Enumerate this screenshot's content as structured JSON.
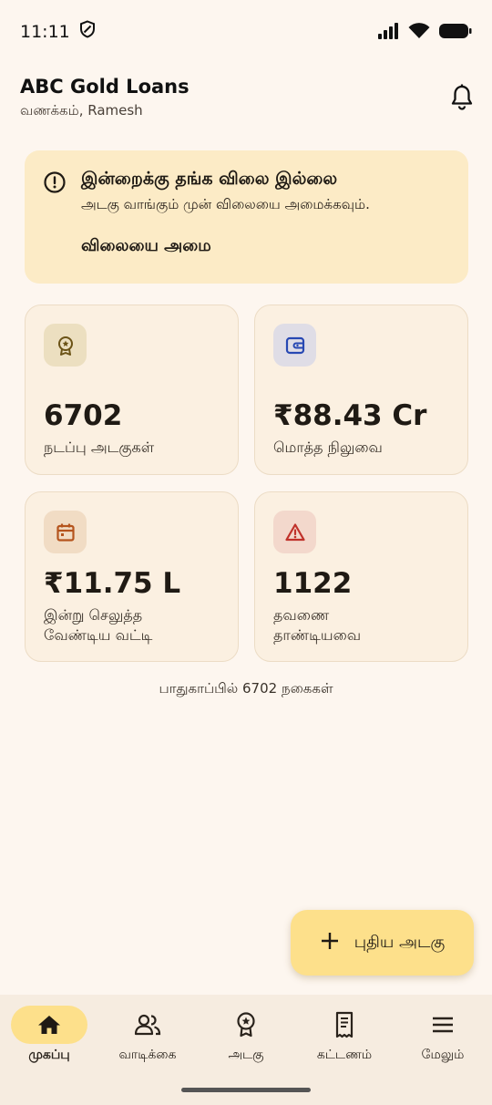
{
  "status_bar": {
    "time": "11:11"
  },
  "header": {
    "title": "ABC Gold Loans",
    "greeting": "வணக்கம், Ramesh"
  },
  "alert": {
    "title": "இன்றைக்கு தங்க விலை இல்லை",
    "subtitle": "அடகு வாங்கும் முன் விலையை அமைக்கவும்.",
    "action_label": "விலையை அமை"
  },
  "stats": [
    {
      "value": "6702",
      "label": "நடப்பு அடகுகள்",
      "icon": "award-icon"
    },
    {
      "value": "₹88.43 Cr",
      "label": "மொத்த நிலுவை",
      "icon": "wallet-icon"
    },
    {
      "value": "₹11.75 L",
      "label_line1": "இன்று செலுத்த",
      "label_line2": "வேண்டிய வட்டி",
      "icon": "calendar-icon"
    },
    {
      "value": "1122",
      "label_line1": "தவணை",
      "label_line2": "தாண்டியவை",
      "icon": "warning-icon"
    }
  ],
  "footnote": "பாதுகாப்பில் 6702 நகைகள்",
  "fab": {
    "label": "புதிய அடகு"
  },
  "nav": [
    {
      "label": "முகப்பு",
      "icon": "home-icon",
      "active": true
    },
    {
      "label": "வாடிக்கை",
      "icon": "users-icon",
      "active": false
    },
    {
      "label": "அடகு",
      "icon": "award-icon",
      "active": false
    },
    {
      "label": "கட்டணம்",
      "icon": "receipt-icon",
      "active": false
    },
    {
      "label": "மேலும்",
      "icon": "menu-icon",
      "active": false
    }
  ],
  "colors": {
    "background": "#fdf6ef",
    "alert_bg": "#fcebc6",
    "card_bg": "#fbf0e1",
    "accent": "#fde08b",
    "danger": "#c0322b"
  }
}
